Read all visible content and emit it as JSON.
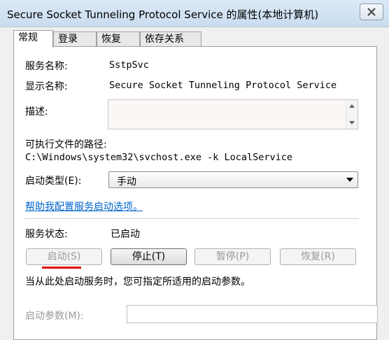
{
  "window": {
    "title": "Secure Socket Tunneling Protocol Service 的属性(本地计算机)",
    "close_icon": "close-icon"
  },
  "tabs": [
    {
      "label": "常规",
      "active": true
    },
    {
      "label": "登录",
      "active": false
    },
    {
      "label": "恢复",
      "active": false
    },
    {
      "label": "依存关系",
      "active": false
    }
  ],
  "general": {
    "service_name_label": "服务名称:",
    "service_name_value": "SstpSvc",
    "display_name_label": "显示名称:",
    "display_name_value": "Secure Socket Tunneling Protocol Service",
    "description_label": "描述:",
    "description_value": "",
    "path_label": "可执行文件的路径:",
    "path_value": "C:\\Windows\\system32\\svchost.exe -k LocalService",
    "startup_type_label": "启动类型(E):",
    "startup_type_value": "手动",
    "help_link": "帮助我配置服务启动选项。",
    "status_label": "服务状态:",
    "status_value": "已启动",
    "buttons": {
      "start": "启动(S)",
      "stop": "停止(T)",
      "pause": "暂停(P)",
      "resume": "恢复(R)"
    },
    "hint_text": "当从此处启动服务时，您可指定所适用的启动参数。",
    "start_params_label": "启动参数(M):",
    "start_params_value": ""
  },
  "colors": {
    "link": "#0066cc",
    "annotation_red": "#e00000",
    "title_gradient": "#c9dcef"
  }
}
